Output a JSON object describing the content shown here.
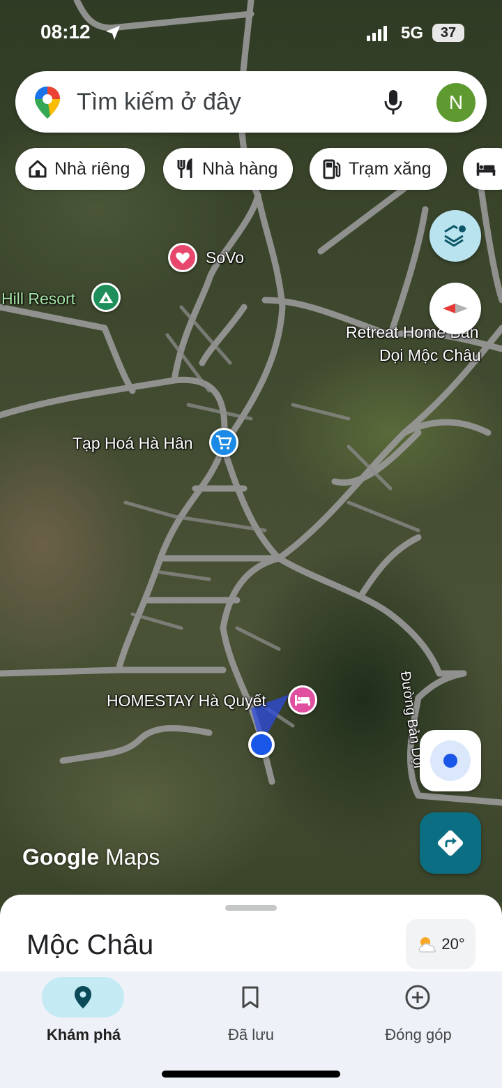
{
  "status_bar": {
    "time": "08:12",
    "network": "5G",
    "battery": "37"
  },
  "search": {
    "placeholder": "Tìm kiếm ở đây",
    "avatar_letter": "N"
  },
  "chips": [
    {
      "label": "Nhà riêng",
      "icon": "home-icon"
    },
    {
      "label": "Nhà hàng",
      "icon": "restaurant-icon"
    },
    {
      "label": "Trạm xăng",
      "icon": "gas-station-icon"
    },
    {
      "label": "",
      "icon": "hotel-icon"
    }
  ],
  "map": {
    "labels": {
      "sovo": "SoVo",
      "hill_resort": "Hill Resort",
      "retreat_line1": "Retreat Home Bản",
      "retreat_line2": "Dọi Mộc Châu",
      "tap_hoa": "Tạp Hoá Hà Hân",
      "homestay": "HOMESTAY Hà Quyết",
      "road": "Đường Bản Dọi"
    },
    "watermark_google": "Google",
    "watermark_maps": "Maps"
  },
  "sheet": {
    "title": "Mộc Châu",
    "temperature": "20°"
  },
  "nav": [
    {
      "label": "Khám phá",
      "icon": "explore-pin-icon",
      "active": true
    },
    {
      "label": "Đã lưu",
      "icon": "bookmark-icon",
      "active": false
    },
    {
      "label": "Đóng góp",
      "icon": "add-circle-icon",
      "active": false
    }
  ],
  "colors": {
    "accent": "#0b6e82",
    "active_pill": "#c4eaf3",
    "location_dot": "#1a56e8"
  }
}
